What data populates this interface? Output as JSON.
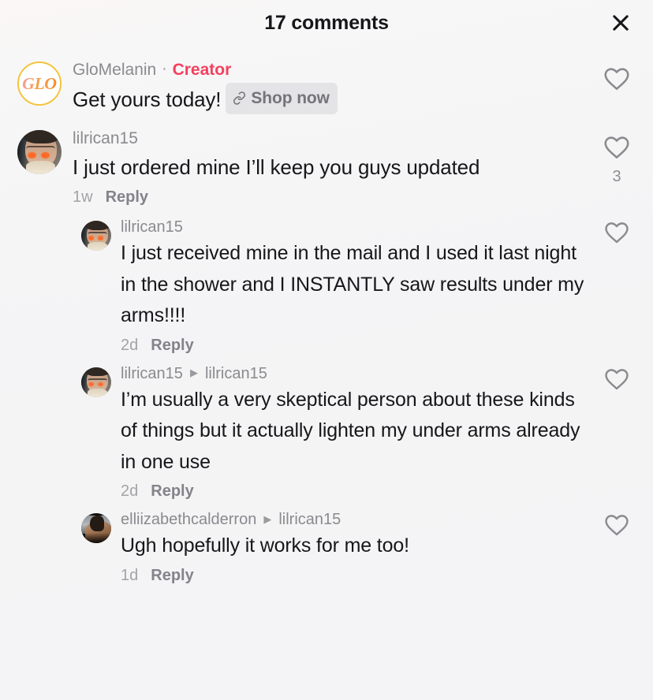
{
  "header": {
    "title": "17 comments",
    "close_icon": "close-icon"
  },
  "comments": [
    {
      "id": "c1",
      "level": 0,
      "avatar_type": "glo-logo",
      "avatar_label": "GLO",
      "username": "GloMelanin",
      "separator": "·",
      "creator_badge": "Creator",
      "text": "Get yours today!",
      "shop_badge": {
        "label": "Shop now",
        "icon": "link-icon"
      },
      "timestamp": "",
      "reply_label": "",
      "like_icon": "heart-outline-icon",
      "like_count": ""
    },
    {
      "id": "c2",
      "level": 0,
      "avatar_type": "photo-a",
      "username": "lilrican15",
      "text": "I just ordered mine I’ll keep you guys updated",
      "timestamp": "1w",
      "reply_label": "Reply",
      "like_icon": "heart-outline-icon",
      "like_count": "3"
    },
    {
      "id": "c3",
      "level": 1,
      "avatar_type": "photo-a",
      "username": "lilrican15",
      "text": "I just received mine in the mail and I used it last night in the shower and I INSTANTLY saw results under my arms!!!!",
      "timestamp": "2d",
      "reply_label": "Reply",
      "like_icon": "heart-outline-icon",
      "like_count": ""
    },
    {
      "id": "c4",
      "level": 1,
      "avatar_type": "photo-a",
      "username": "lilrican15",
      "reply_arrow": "▶",
      "reply_to": "lilrican15",
      "text": "I’m usually a very skeptical person about these kinds of things but it actually lighten my under arms already in one use",
      "timestamp": "2d",
      "reply_label": "Reply",
      "like_icon": "heart-outline-icon",
      "like_count": ""
    },
    {
      "id": "c5",
      "level": 1,
      "avatar_type": "photo-b",
      "username": "elliizabethcalderron",
      "reply_arrow": "▶",
      "reply_to": "lilrican15",
      "text": "Ugh hopefully it works for me too!",
      "timestamp": "1d",
      "reply_label": "Reply",
      "like_icon": "heart-outline-icon",
      "like_count": ""
    }
  ],
  "colors": {
    "background": "#f4f4f5",
    "background_top": "#faf7f6",
    "text_primary": "#17161a",
    "text_muted": "#8a8a8f",
    "creator_accent": "#f4405e",
    "heart_outline": "#8a8a8f",
    "badge_background": "#e4e3e5",
    "glo_ring": "#f2c53d"
  }
}
